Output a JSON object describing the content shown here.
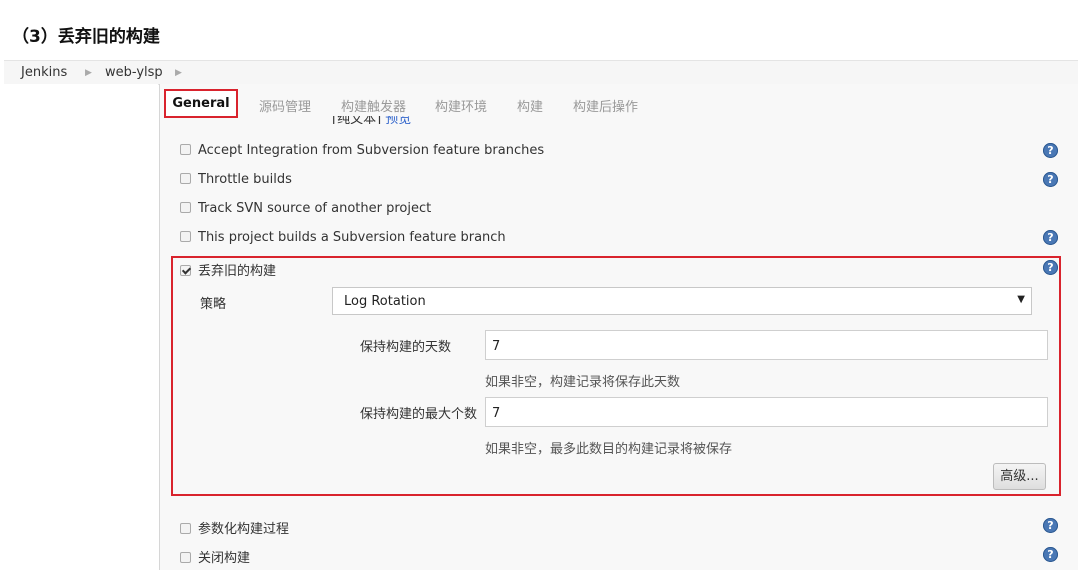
{
  "heading": "（3）丢弃旧的构建",
  "breadcrumb": [
    "Jenkins",
    "web-ylsp"
  ],
  "tabs": [
    "General",
    "源码管理",
    "构建触发器",
    "构建环境",
    "构建",
    "构建后操作"
  ],
  "clipped_text": {
    "plain": "[纯文本]",
    "link": "预览"
  },
  "options_top": [
    {
      "label": "Accept Integration from Subversion feature branches",
      "checked": false,
      "help": true
    },
    {
      "label": "Throttle builds",
      "checked": false,
      "help": true
    },
    {
      "label": "Track SVN source of another project",
      "checked": false,
      "help": false
    },
    {
      "label": "This project builds a Subversion feature branch",
      "checked": false,
      "help": true
    }
  ],
  "discard": {
    "label": "丢弃旧的构建",
    "checked": true,
    "strategy_label": "策略",
    "strategy_value": "Log Rotation",
    "days_label": "保持构建的天数",
    "days_value": "7",
    "days_hint": "如果非空，构建记录将保存此天数",
    "max_label": "保持构建的最大个数",
    "max_value": "7",
    "max_hint": "如果非空，最多此数目的构建记录将被保存",
    "advanced_button": "高级..."
  },
  "options_bottom": [
    {
      "label": "参数化构建过程",
      "checked": false,
      "help": true
    },
    {
      "label": "关闭构建",
      "checked": false,
      "help": true
    }
  ],
  "help_glyph": "?",
  "colors": {
    "highlight": "#d9232d",
    "help": "#4a78b5",
    "link": "#3366cc"
  }
}
